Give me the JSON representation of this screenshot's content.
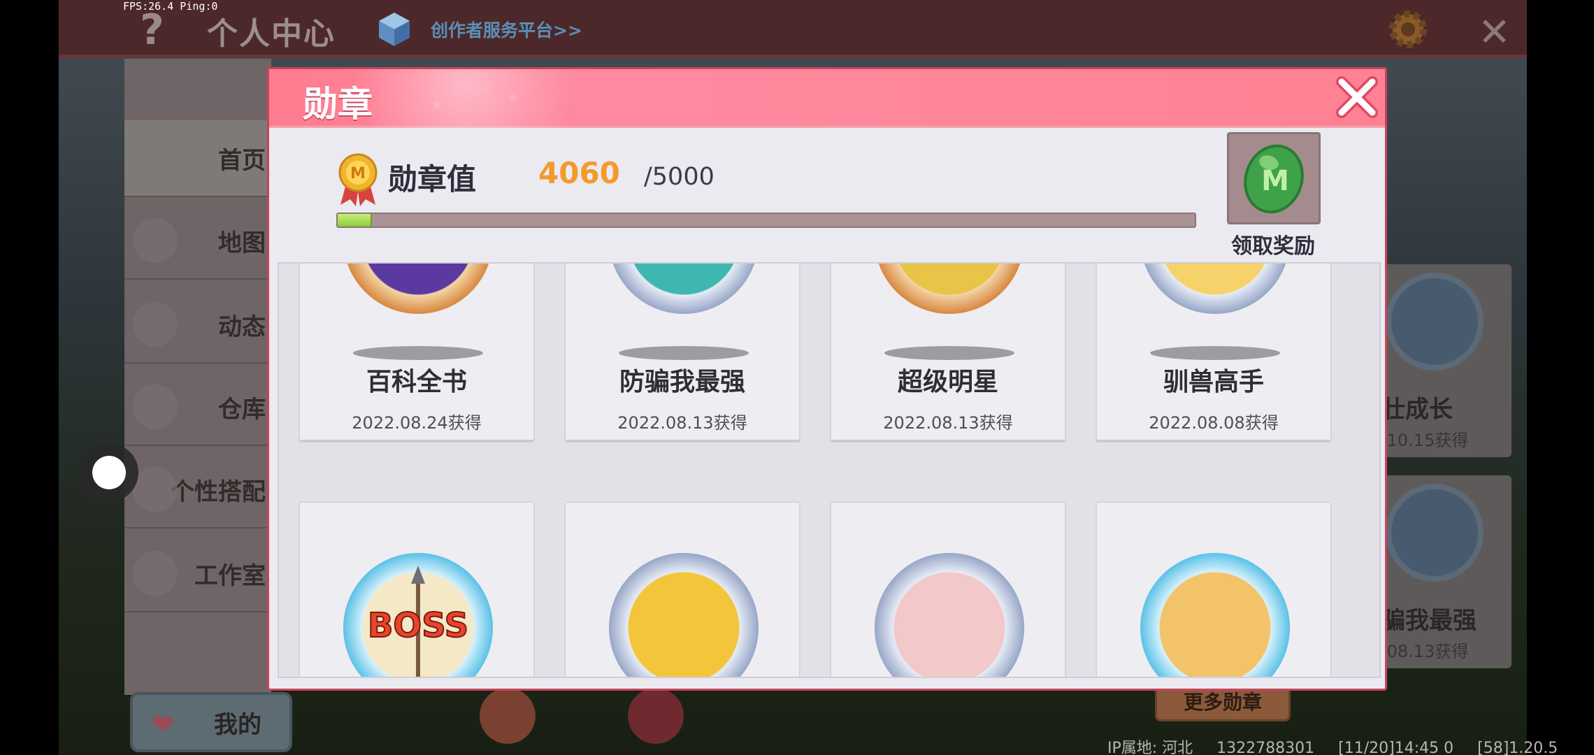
{
  "status": {
    "fps": "FPS:26.4  Ping:0"
  },
  "topbar": {
    "help_icon": "question-icon",
    "title": "个人中心",
    "creator_link": "创作者服务平台>>",
    "settings_icon": "gear-icon",
    "close_icon": "close-icon"
  },
  "nav": {
    "items": [
      {
        "label": "首页",
        "active": true
      },
      {
        "label": "地图"
      },
      {
        "label": "动态"
      },
      {
        "label": "仓库"
      },
      {
        "label": "个性搭配"
      },
      {
        "label": "工作室"
      }
    ],
    "mine": "我的"
  },
  "modal": {
    "title": "勋章",
    "value_label": "勋章值",
    "value_current": "4060",
    "value_max": "/5000",
    "progress": {
      "current": 4060,
      "max": 5000,
      "display_fraction": 0.04
    },
    "reward_label": "领取奖励",
    "badges": [
      {
        "name": "百科全书",
        "date": "2022.08.24获得",
        "ring": "bronze"
      },
      {
        "name": "防骗我最强",
        "date": "2022.08.13获得",
        "ring": "silver"
      },
      {
        "name": "超级明星",
        "date": "2022.08.13获得",
        "ring": "bronze"
      },
      {
        "name": "驯兽高手",
        "date": "2022.08.08获得",
        "ring": "silver"
      },
      {
        "name": "",
        "date": "",
        "ring": "diamond",
        "art": "BOSS"
      },
      {
        "name": "",
        "date": "",
        "ring": "silver"
      },
      {
        "name": "",
        "date": "",
        "ring": "silver"
      },
      {
        "name": "",
        "date": "",
        "ring": "diamond"
      }
    ]
  },
  "right_cards": [
    {
      "name": "壮成长",
      "date": ".10.15获得"
    },
    {
      "name": "骗我最强",
      "date": ".08.13获得"
    }
  ],
  "more_badges": "更多勋章",
  "footer": {
    "ip": "IP属地: 河北",
    "uid": "1322788301",
    "time": "[11/20]14:45 0",
    "version": "[58]1.20.5"
  },
  "colors": {
    "header_pink": "#ff7c90",
    "value_orange": "#f49a2a",
    "progress_green": "#8dcc3b",
    "bronze": "#d98a43",
    "silver": "#9aa9c9",
    "diamond": "#5fc3e8"
  }
}
